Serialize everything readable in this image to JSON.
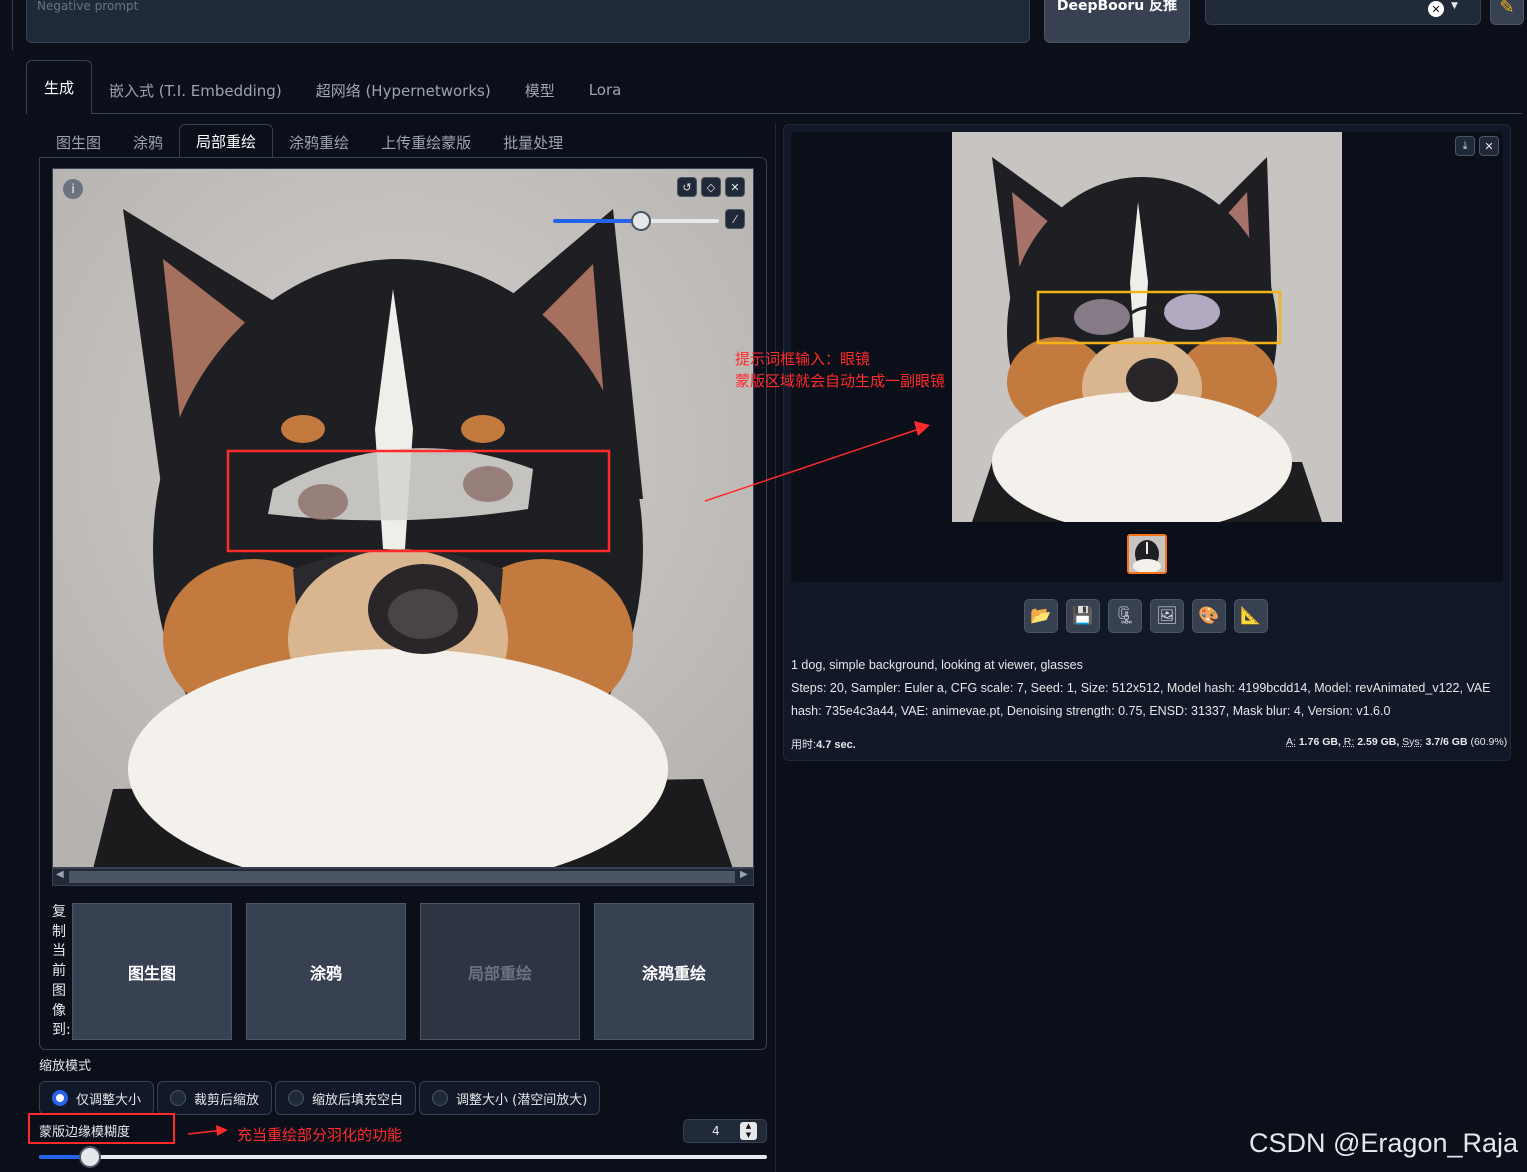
{
  "prompt": {
    "negative_placeholder": "Negative prompt"
  },
  "top_buttons": {
    "deepbooru": "DeepBooru 反推"
  },
  "main_tabs": [
    "生成",
    "嵌入式 (T.I. Embedding)",
    "超网络 (Hypernetworks)",
    "模型",
    "Lora"
  ],
  "sub_tabs": [
    "图生图",
    "涂鸦",
    "局部重绘",
    "涂鸦重绘",
    "上传重绘蒙版",
    "批量处理"
  ],
  "copy_to": {
    "label_chars": [
      "复",
      "制",
      "当",
      "前",
      "图",
      "像",
      "到:"
    ],
    "buttons": [
      "图生图",
      "涂鸦",
      "局部重绘",
      "涂鸦重绘"
    ]
  },
  "resize_mode": {
    "label": "缩放模式",
    "options": [
      "仅调整大小",
      "裁剪后缩放",
      "缩放后填充空白",
      "调整大小 (潜空间放大)"
    ],
    "selected": 0
  },
  "mask_blur": {
    "label": "蒙版边缘模糊度",
    "value": "4",
    "slider_fraction": 0.07
  },
  "brush_slider_fraction": 0.53,
  "annotations": {
    "right_line1": "提示词框输入：眼镜",
    "right_line2": "蒙版区域就会自动生成一副眼镜",
    "blur_note": "充当重绘部分羽化的功能"
  },
  "output": {
    "prompt_text": "1 dog, simple background, looking at viewer, glasses",
    "params_line1": "Steps: 20, Sampler: Euler a, CFG scale: 7, Seed: 1, Size: 512x512, Model hash: 4199bcdd14, Model: revAnimated_v122, VAE",
    "params_line2": "hash: 735e4c3a44, VAE: animevae.pt, Denoising strength: 0.75, ENSD: 31337, Mask blur: 4, Version: v1.6.0",
    "time_label": "用时:",
    "time_value": "4.7 sec.",
    "mem_a_label": "A:",
    "mem_a": "1.76 GB,",
    "mem_r_label": "R:",
    "mem_r": "2.59 GB,",
    "mem_sys_label": "Sys:",
    "mem_sys": "3.7/6 GB",
    "mem_pct": "(60.9%)"
  },
  "watermark": "CSDN @Eragon_Raja",
  "colors": {
    "accent": "#2563eb",
    "annotation_red": "#ff2a2a",
    "highlight_orange": "#f5b31a",
    "thumb_border": "#f97316"
  }
}
